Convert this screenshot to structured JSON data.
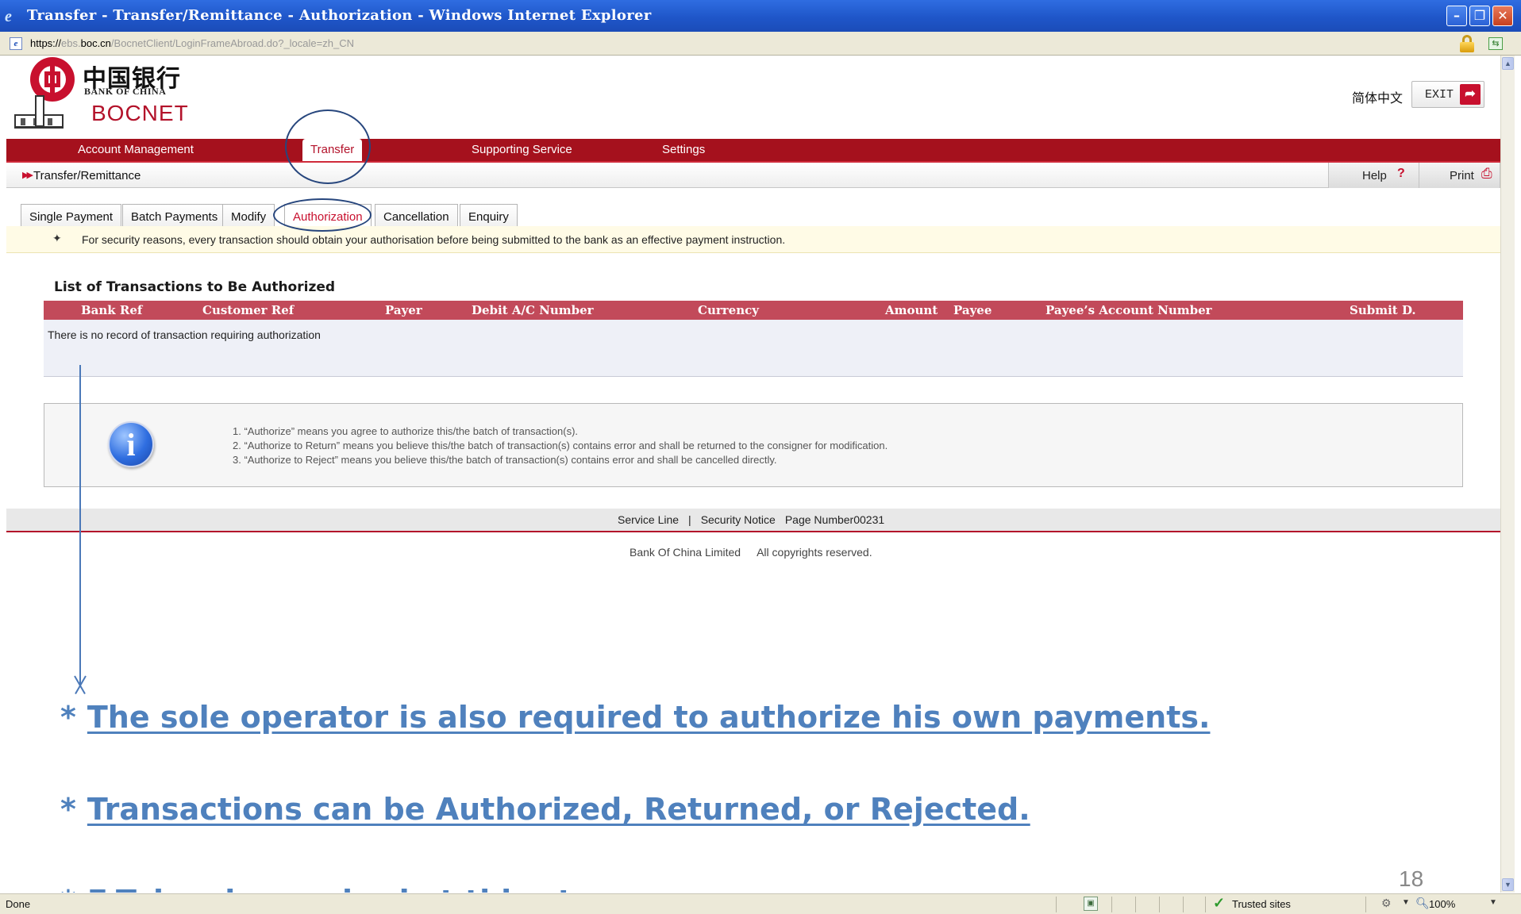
{
  "window": {
    "title": "Transfer - Transfer/Remittance - Authorization - Windows Internet Explorer",
    "min_glyph": "–",
    "max_glyph": "❐",
    "close_glyph": "✕"
  },
  "address": {
    "protocol": "https://",
    "host_prefix": "ebs.",
    "host": "boc.cn",
    "path": "/BocnetClient/LoginFrameAbroad.do?_locale=zh_CN"
  },
  "header": {
    "bank_name_cn": "中国银行",
    "bank_name_en": "BANK OF CHINA",
    "product": "BOCNET",
    "language_link": "简体中文",
    "exit_label": "EXIT",
    "exit_icon_glyph": "➦"
  },
  "nav": {
    "items": [
      {
        "label": "Account Management"
      },
      {
        "label": "Transfer",
        "active": true
      },
      {
        "label": "Supporting Service"
      },
      {
        "label": "Settings"
      }
    ]
  },
  "breadcrumb": {
    "label": "Transfer/Remittance",
    "help_label": "Help",
    "print_label": "Print"
  },
  "tabs": [
    {
      "label": "Single Payment"
    },
    {
      "label": "Batch Payments"
    },
    {
      "label": "Modify"
    },
    {
      "label": "Authorization",
      "active": true
    },
    {
      "label": "Cancellation"
    },
    {
      "label": "Enquiry"
    }
  ],
  "notice": "For security reasons, every transaction should obtain your authorisation before being submitted to the bank as an effective payment instruction.",
  "list": {
    "title": "List of Transactions to Be Authorized",
    "columns": [
      "Bank Ref",
      "Customer Ref",
      "Payer",
      "Debit A/C Number",
      "Currency",
      "Amount",
      "Payee",
      "Payee’s Account Number",
      "Submit D."
    ],
    "empty_message": "There is no record of transaction requiring authorization"
  },
  "info": {
    "lines": [
      "1. “Authorize” means you agree to authorize this/the batch of transaction(s).",
      "2. “Authorize to Return” means you believe this/the batch of transaction(s) contains error and shall be returned to the consigner for modification.",
      "3. “Authorize to Reject” means you believe this/the batch of transaction(s) contains error and shall be cancelled directly."
    ]
  },
  "footer": {
    "service_line": "Service Line",
    "security_notice": "Security Notice",
    "page_number": "Page Number00231",
    "company": "Bank Of China Limited",
    "rights": "All copyrights reserved."
  },
  "annotations": {
    "notes": [
      "The sole operator is also required to authorize his own payments.",
      "Transactions can be Authorized, Returned, or Rejected.",
      "E-Token is required at this step."
    ],
    "bullet": "*",
    "slide_number": "18"
  },
  "status": {
    "left": "Done",
    "zone": "Trusted sites",
    "zoom": "100%"
  },
  "colors": {
    "brand_red": "#a5111d",
    "table_header": "#c24a5a",
    "annotation_blue": "#4f81bd",
    "circle_blue": "#27467d"
  }
}
